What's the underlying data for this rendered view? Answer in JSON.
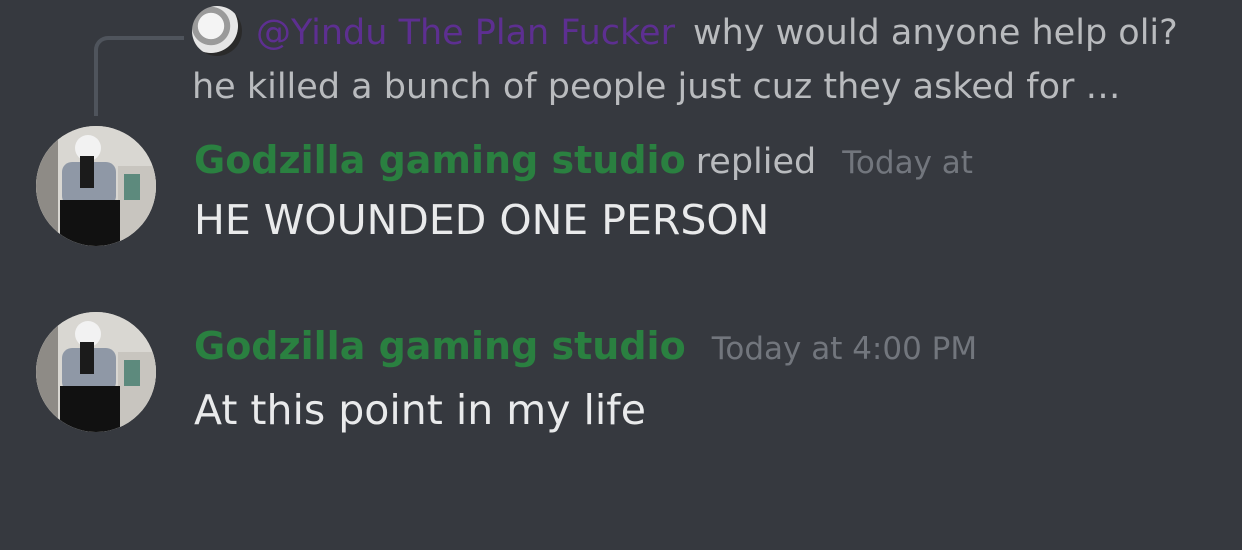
{
  "reply_preview": {
    "mention": "@Yindu The Plan Fucker",
    "text_line1": "why would anyone help oli?",
    "text_line2": "he killed a bunch of people just cuz they asked for …"
  },
  "messages": [
    {
      "username": "Godzilla gaming studio",
      "replied_label": "replied",
      "timestamp": "Today at",
      "lines": [
        "HE WOUNDED ONE PERSON"
      ]
    },
    {
      "username": "Godzilla gaming studio",
      "timestamp": "Today at 4:00 PM",
      "lines": [
        "At this point in my life"
      ]
    }
  ],
  "colors": {
    "background": "#36393f",
    "username": "#2a8040",
    "mention": "#5d2f91",
    "timestamp": "#72767d",
    "reply_text": "#b9bbbe",
    "message_text": "#e9eaeb"
  }
}
